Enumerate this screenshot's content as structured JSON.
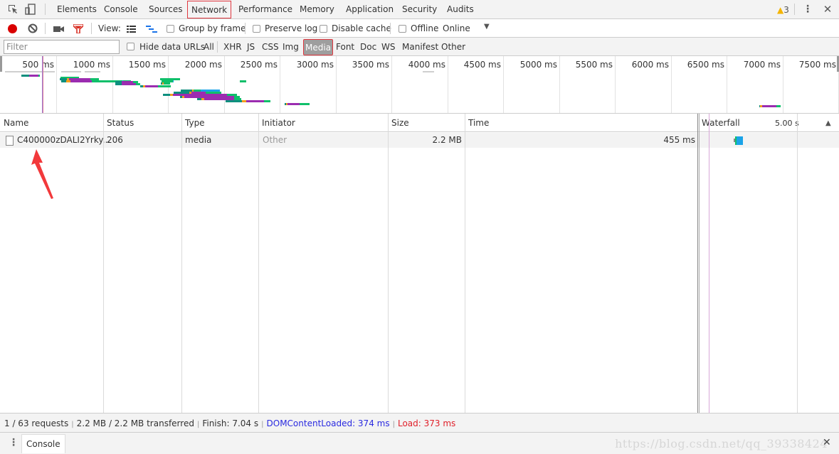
{
  "tabs": [
    {
      "label": "Elements"
    },
    {
      "label": "Console"
    },
    {
      "label": "Sources"
    },
    {
      "label": "Network",
      "active": true
    },
    {
      "label": "Performance"
    },
    {
      "label": "Memory"
    },
    {
      "label": "Application"
    },
    {
      "label": "Security"
    },
    {
      "label": "Audits"
    }
  ],
  "warnings": {
    "count": "3",
    "color": "#f4b400"
  },
  "toolbar": {
    "view_label": "View:",
    "group_by_frame": "Group by frame",
    "preserve_log": "Preserve log",
    "disable_cache": "Disable cache",
    "offline": "Offline",
    "throttle_value": "Online",
    "record_color": "#d90000",
    "filter_icon_color": "#d93025"
  },
  "filterbar": {
    "placeholder": "Filter",
    "value": "",
    "hide_data_urls": "Hide data URLs",
    "types": [
      {
        "label": "All"
      },
      {
        "label": "XHR"
      },
      {
        "label": "JS"
      },
      {
        "label": "CSS"
      },
      {
        "label": "Img"
      },
      {
        "label": "Media",
        "active": true
      },
      {
        "label": "Font"
      },
      {
        "label": "Doc"
      },
      {
        "label": "WS"
      },
      {
        "label": "Manifest"
      },
      {
        "label": "Other"
      }
    ]
  },
  "overview": {
    "ticks": [
      "500 ms",
      "1000 ms",
      "1500 ms",
      "2000 ms",
      "2500 ms",
      "3000 ms",
      "3500 ms",
      "4000 ms",
      "4500 ms",
      "5000 ms",
      "5500 ms",
      "6000 ms",
      "6500 ms",
      "7000 ms",
      "7500 ms"
    ],
    "colors": {
      "waiting": "#0e8f7e",
      "queue": "#f59f1e",
      "download": "#9b2cb0",
      "receive": "#0fbf6a",
      "content": "#1aa3e8",
      "load_line": "#9b7bd4",
      "dom_line": "#e0819a"
    }
  },
  "table": {
    "columns": [
      {
        "label": "Name"
      },
      {
        "label": "Status"
      },
      {
        "label": "Type"
      },
      {
        "label": "Initiator"
      },
      {
        "label": "Size"
      },
      {
        "label": "Time"
      },
      {
        "label": "Waterfall"
      }
    ],
    "waterfall_scale": "5.00 s",
    "sort_indicator": "▲",
    "rows": [
      {
        "name": "C400000zDALI2Yrky...",
        "status": "206",
        "type": "media",
        "initiator": "Other",
        "size": "2.2 MB",
        "time": "455 ms"
      }
    ]
  },
  "statusbar": {
    "requests": "1 / 63 requests",
    "transferred": "2.2 MB / 2.2 MB transferred",
    "finish": "Finish: 7.04 s",
    "dom_content_loaded": "DOMContentLoaded: 374 ms",
    "load": "Load: 373 ms",
    "dom_color": "#2a2ae0",
    "load_color": "#e0202a"
  },
  "drawer": {
    "tab_label": "Console"
  },
  "watermark": "https://blog.csdn.net/qq_39338424"
}
